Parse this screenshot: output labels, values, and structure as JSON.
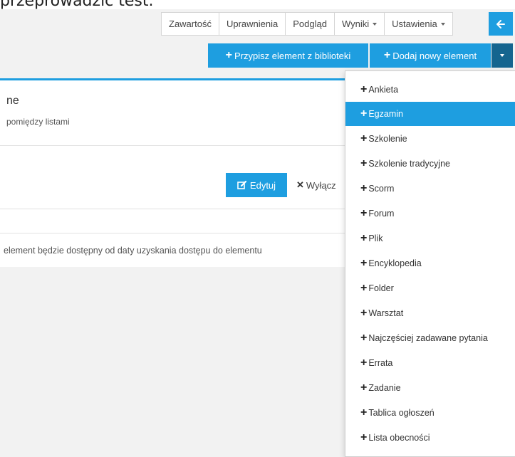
{
  "caption": "przeprowadzić test.",
  "tabs": [
    {
      "label": "Zawartość",
      "dropdown": false
    },
    {
      "label": "Uprawnienia",
      "dropdown": false
    },
    {
      "label": "Podgląd",
      "dropdown": false
    },
    {
      "label": "Wyniki",
      "dropdown": true
    },
    {
      "label": "Ustawienia",
      "dropdown": true
    }
  ],
  "toolbar": {
    "assign_label": "Przypisz element z biblioteki",
    "add_label": "Dodaj nowy element"
  },
  "panel": {
    "title": "ne",
    "subtitle": "pomiędzy listami",
    "edit_label": "Edytuj",
    "disable_label": "Wyłącz",
    "availability": "element będzie dostępny od daty uzyskania dostępu do elementu"
  },
  "dropdown_items": [
    {
      "label": "Ankieta",
      "active": false
    },
    {
      "label": "Egzamin",
      "active": true
    },
    {
      "label": "Szkolenie",
      "active": false
    },
    {
      "label": "Szkolenie tradycyjne",
      "active": false
    },
    {
      "label": "Scorm",
      "active": false
    },
    {
      "label": "Forum",
      "active": false
    },
    {
      "label": "Plik",
      "active": false
    },
    {
      "label": "Encyklopedia",
      "active": false
    },
    {
      "label": "Folder",
      "active": false
    },
    {
      "label": "Warsztat",
      "active": false
    },
    {
      "label": "Najczęściej zadawane pytania",
      "active": false
    },
    {
      "label": "Errata",
      "active": false
    },
    {
      "label": "Zadanie",
      "active": false
    },
    {
      "label": "Tablica ogłoszeń",
      "active": false
    },
    {
      "label": "Lista obecności",
      "active": false
    }
  ],
  "colors": {
    "accent": "#1e9ee0",
    "accent_dark": "#15658f",
    "background": "#f2f2f2"
  }
}
